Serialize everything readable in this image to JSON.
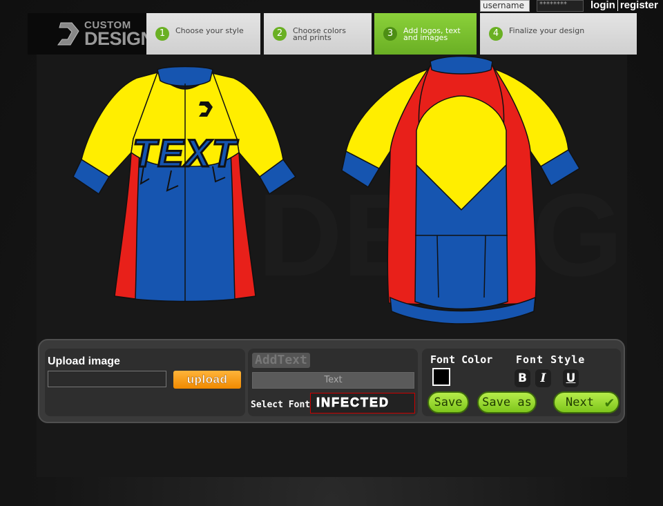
{
  "login": {
    "username_placeholder": "username",
    "password_placeholder": "********",
    "login_label": "login",
    "register_label": "register"
  },
  "logo": {
    "line1": "CUSTOM",
    "line2": "DESIGN"
  },
  "steps": [
    {
      "num": "1",
      "label": "Choose your style",
      "active": false
    },
    {
      "num": "2",
      "label": "Choose colors and prints",
      "active": false
    },
    {
      "num": "3",
      "label": "Add logos, text and images",
      "active": true
    },
    {
      "num": "4",
      "label": "Finalize your design",
      "active": false
    }
  ],
  "jersey": {
    "front_text": "TEXT",
    "colors": {
      "yellow": "#ffee00",
      "blue": "#1655b0",
      "red": "#e8201a",
      "outline": "#111111"
    }
  },
  "upload": {
    "title": "Upload image",
    "button": "upload"
  },
  "addtext": {
    "title": "AddText",
    "input_value": "Text",
    "font_label": "Select Font",
    "font_name": "INFECTED"
  },
  "style": {
    "font_color_label": "Font Color",
    "font_style_label": "Font Style",
    "bold": "B",
    "italic": "I",
    "underline": "U",
    "font_color": "#000000",
    "save": "Save",
    "save_as": "Save as",
    "next": "Next"
  }
}
